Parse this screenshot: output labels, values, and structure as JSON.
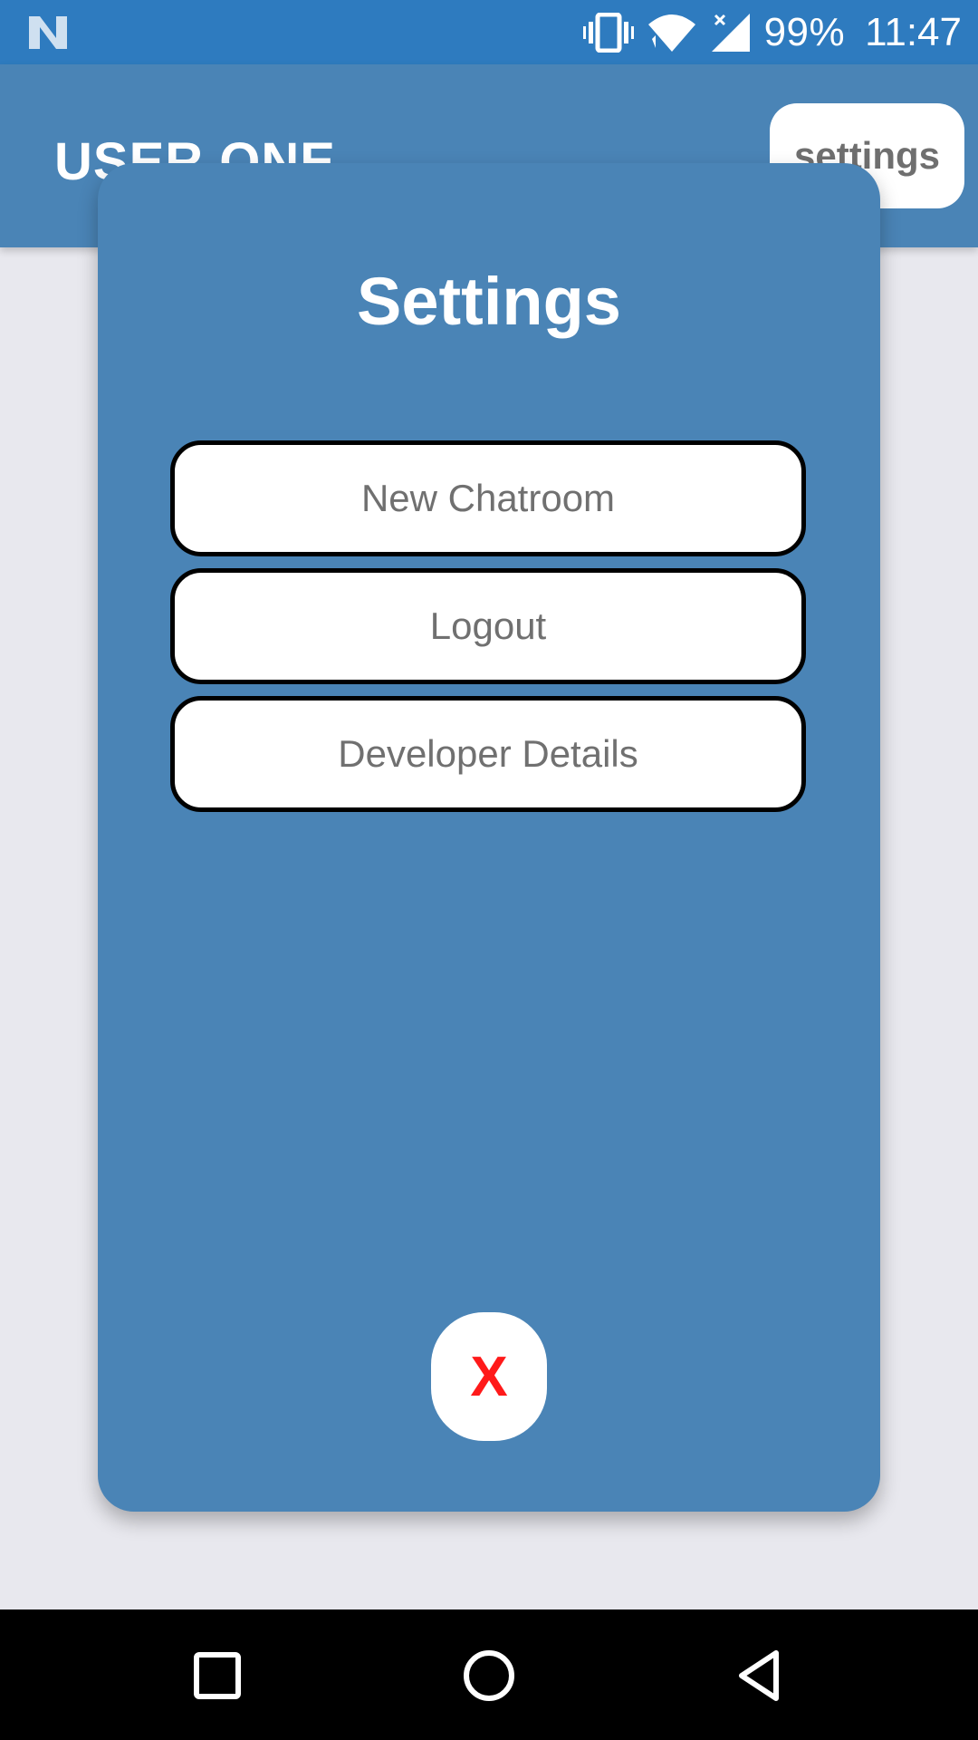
{
  "status_bar": {
    "battery": "99%",
    "time": "11:47",
    "icons": [
      "notification-n-icon",
      "vibrate-icon",
      "wifi-icon",
      "signal-icon"
    ]
  },
  "app_bar": {
    "title": "USER ONE",
    "settings_label": "settings"
  },
  "modal": {
    "title": "Settings",
    "buttons": [
      "New Chatroom",
      "Logout",
      "Developer Details"
    ],
    "close_label": "X"
  },
  "colors": {
    "status_bar": "#2e7bbf",
    "primary": "#4a84b6",
    "background": "#e8e8ee",
    "close": "#ff1a1a"
  },
  "nav_bar": {
    "icons": [
      "recents-icon",
      "home-icon",
      "back-icon"
    ]
  }
}
